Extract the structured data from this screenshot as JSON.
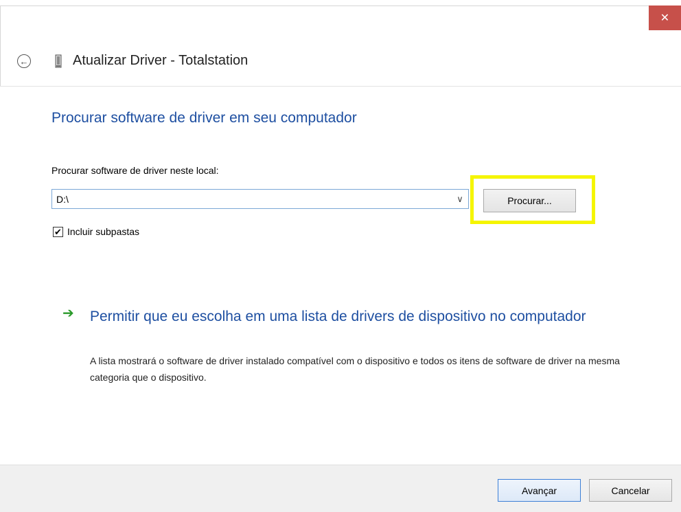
{
  "window": {
    "title": "Atualizar Driver -  Totalstation",
    "close_glyph": "✕",
    "back_glyph": "←",
    "icons": [
      "back-arrow-icon",
      "device-icon",
      "close-icon"
    ]
  },
  "page": {
    "title": "Procurar software de driver em seu computador",
    "path_label": "Procurar software de driver neste local:",
    "path_value": "D:\\",
    "browse_label": "Procurar...",
    "include_subfolders_label": "Incluir subpastas",
    "include_subfolders_checked": true,
    "checkbox_glyph": "✔"
  },
  "option": {
    "arrow_glyph": "➔",
    "title": "Permitir que eu escolha em uma lista de drivers de dispositivo no computador",
    "description": "A lista mostrará o software de driver instalado compatível com o dispositivo e todos os itens de software de driver na mesma categoria que o dispositivo."
  },
  "footer": {
    "next_label": "Avançar",
    "cancel_label": "Cancelar"
  },
  "colors": {
    "accent_blue": "#1e4fa1",
    "close_red": "#c7504a",
    "highlight_yellow": "#f5f500",
    "arrow_green": "#2b9a2b",
    "footer_gray": "#f0f0f0"
  }
}
